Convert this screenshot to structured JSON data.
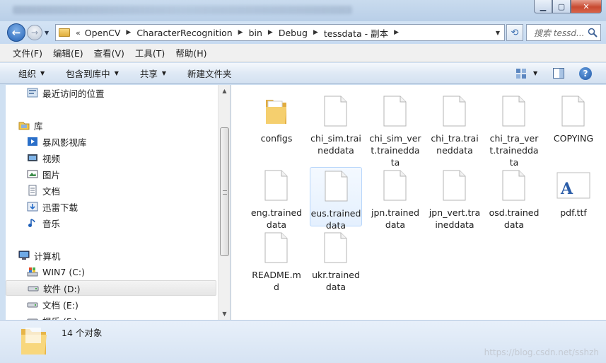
{
  "window": {
    "address_path": [
      "OpenCV",
      "CharacterRecognition",
      "bin",
      "Debug",
      "tessdata - 副本"
    ],
    "search_placeholder": "搜索 tessd...",
    "buttons": [
      "minimize",
      "maximize",
      "close"
    ]
  },
  "menu": [
    "文件(F)",
    "编辑(E)",
    "查看(V)",
    "工具(T)",
    "帮助(H)"
  ],
  "toolbar": {
    "organize": "组织",
    "include_in_library": "包含到库中",
    "share": "共享",
    "new_folder": "新建文件夹"
  },
  "sidebar": {
    "items": [
      {
        "label": "最近访问的位置",
        "icon": "recent-places-icon",
        "indent": 1
      },
      {
        "label": "库",
        "icon": "library-icon",
        "indent": 0
      },
      {
        "label": "暴风影视库",
        "icon": "video-library-icon",
        "indent": 1
      },
      {
        "label": "视频",
        "icon": "video-icon",
        "indent": 1
      },
      {
        "label": "图片",
        "icon": "pictures-icon",
        "indent": 1
      },
      {
        "label": "文档",
        "icon": "documents-icon",
        "indent": 1
      },
      {
        "label": "迅雷下载",
        "icon": "download-icon",
        "indent": 1
      },
      {
        "label": "音乐",
        "icon": "music-icon",
        "indent": 1
      },
      {
        "label": "计算机",
        "icon": "computer-icon",
        "indent": 0
      },
      {
        "label": "WIN7 (C:)",
        "icon": "windows-drive-icon",
        "indent": 1
      },
      {
        "label": "软件 (D:)",
        "icon": "drive-icon",
        "indent": 1,
        "selected": true
      },
      {
        "label": "文档 (E:)",
        "icon": "drive-icon",
        "indent": 1
      },
      {
        "label": "娱乐 (F:)",
        "icon": "drive-icon",
        "indent": 1
      }
    ]
  },
  "files": [
    {
      "name": "configs",
      "type": "folder"
    },
    {
      "name": "chi_sim.traineddata",
      "type": "file"
    },
    {
      "name": "chi_sim_vert.traineddata",
      "type": "file"
    },
    {
      "name": "chi_tra.traineddata",
      "type": "file"
    },
    {
      "name": "chi_tra_vert.traineddata",
      "type": "file"
    },
    {
      "name": "COPYING",
      "type": "file"
    },
    {
      "name": "eng.traineddata",
      "type": "file"
    },
    {
      "name": "eus.traineddata",
      "type": "file",
      "hover": true
    },
    {
      "name": "jpn.traineddata",
      "type": "file"
    },
    {
      "name": "jpn_vert.traineddata",
      "type": "file"
    },
    {
      "name": "osd.traineddata",
      "type": "file"
    },
    {
      "name": "pdf.ttf",
      "type": "font"
    },
    {
      "name": "README.md",
      "type": "file"
    },
    {
      "name": "ukr.traineddata",
      "type": "file"
    }
  ],
  "status": {
    "item_count": "14 个对象"
  },
  "watermark": "https://blog.csdn.net/sshzh",
  "colors": {
    "titlebar": "#c9dbee",
    "accent": "#2361b5",
    "hover": "#e4f0fe"
  }
}
